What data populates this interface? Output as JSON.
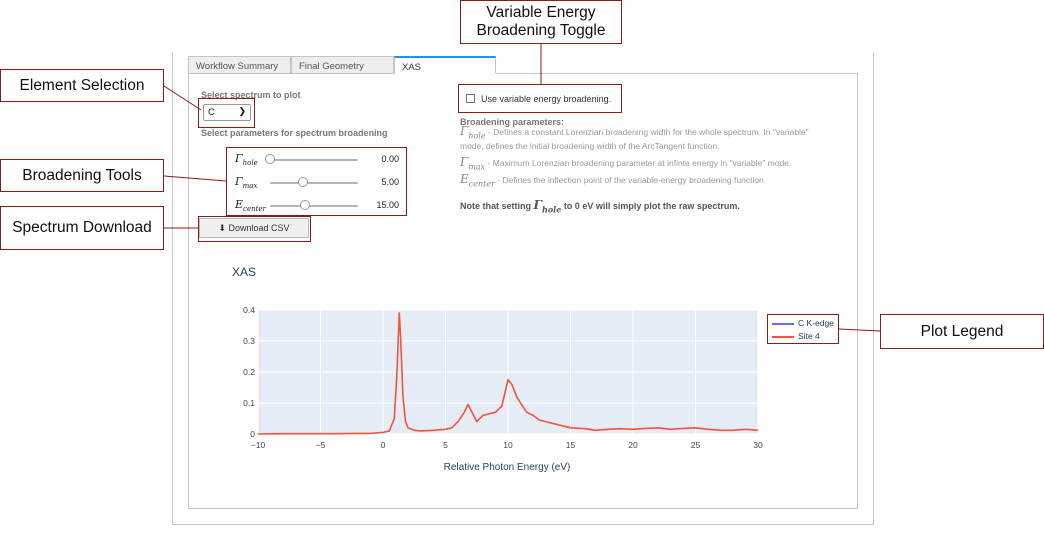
{
  "tabs": [
    {
      "label": "Workflow Summary",
      "active": false
    },
    {
      "label": "Final Geometry",
      "active": false
    },
    {
      "label": "XAS",
      "active": true
    }
  ],
  "controls": {
    "select_label": "Select spectrum to plot",
    "select_value": "C",
    "broadening_label": "Select parameters for spectrum broadening",
    "sliders": [
      {
        "symbol": "Γ",
        "sub": "hole",
        "value": "0.00",
        "level": 0.0
      },
      {
        "symbol": "Γ",
        "sub": "max",
        "value": "5.00",
        "level": 0.38
      },
      {
        "symbol": "E",
        "sub": "center",
        "value": "15.00",
        "level": 0.4
      }
    ],
    "download_label": "Download CSV",
    "download_icon": "download-icon"
  },
  "variable_broadening": {
    "label": "Use variable energy broadening.",
    "checked": false
  },
  "description": {
    "header": "Broadening parameters:",
    "gamma_hole_sub": "hole",
    "gamma_hole_text_1": " - Defines a constant Lorenzian broadening width for the whole spectrum. In \"variable\"",
    "gamma_hole_text_2": "mode, defines the initial broadening width of the ArcTangent function.",
    "gamma_max_sub": "max",
    "gamma_max_text": " - Maximum Lorenzian broadening parameter at infinte energy in \"variable\" mode.",
    "e_center_sub": "center",
    "e_center_text": " - Defines the inflection point of the variable-energy broadening function.",
    "note_prefix": "Note that setting ",
    "note_sub": "hole",
    "note_suffix": " to 0 eV will simply plot the raw spectrum."
  },
  "annotations": {
    "variable_toggle": "Variable Energy Broadening Toggle",
    "element_selection": "Element Selection",
    "broadening_tools": "Broadening Tools",
    "spectrum_download": "Spectrum Download",
    "plot_legend": "Plot Legend"
  },
  "colors": {
    "accent": "#1e90ff",
    "annotation_border": "#8b1a1a",
    "series_c_kedge": "#636efa",
    "series_site4": "#ef553b",
    "plot_bg": "#e5ecf6"
  },
  "chart_data": {
    "type": "line",
    "title": "XAS",
    "xlabel": "Relative Photon Energy (eV)",
    "ylabel": "",
    "xlim": [
      -10,
      30
    ],
    "ylim": [
      0,
      0.4
    ],
    "xticks": [
      -10,
      -5,
      0,
      5,
      10,
      15,
      20,
      25,
      30
    ],
    "yticks": [
      0,
      0.1,
      0.2,
      0.3,
      0.4
    ],
    "grid": true,
    "legend_position": "right",
    "series": [
      {
        "name": "C K-edge",
        "x": [],
        "y": []
      },
      {
        "name": "Site 4",
        "x": [
          -10,
          -8,
          -6,
          -4,
          -2,
          -1,
          0,
          0.5,
          0.9,
          1.1,
          1.3,
          1.4,
          1.6,
          1.8,
          2.0,
          2.5,
          3,
          4,
          5,
          5.5,
          6,
          6.5,
          6.8,
          7.0,
          7.5,
          8.0,
          8.5,
          9.0,
          9.5,
          10.0,
          10.3,
          10.7,
          11.0,
          11.5,
          12.0,
          12.5,
          13.0,
          13.5,
          14,
          15,
          16,
          17,
          18,
          19,
          20,
          21,
          22,
          23,
          24,
          25,
          26,
          27,
          28,
          29,
          30
        ],
        "y": [
          0.0,
          0.001,
          0.001,
          0.001,
          0.002,
          0.002,
          0.005,
          0.01,
          0.05,
          0.18,
          0.39,
          0.32,
          0.12,
          0.04,
          0.02,
          0.012,
          0.01,
          0.012,
          0.015,
          0.02,
          0.04,
          0.07,
          0.095,
          0.08,
          0.04,
          0.06,
          0.065,
          0.07,
          0.09,
          0.175,
          0.16,
          0.12,
          0.1,
          0.07,
          0.06,
          0.045,
          0.04,
          0.035,
          0.03,
          0.02,
          0.018,
          0.012,
          0.015,
          0.017,
          0.015,
          0.018,
          0.02,
          0.015,
          0.018,
          0.02,
          0.015,
          0.012,
          0.012,
          0.015,
          0.012
        ]
      }
    ]
  }
}
